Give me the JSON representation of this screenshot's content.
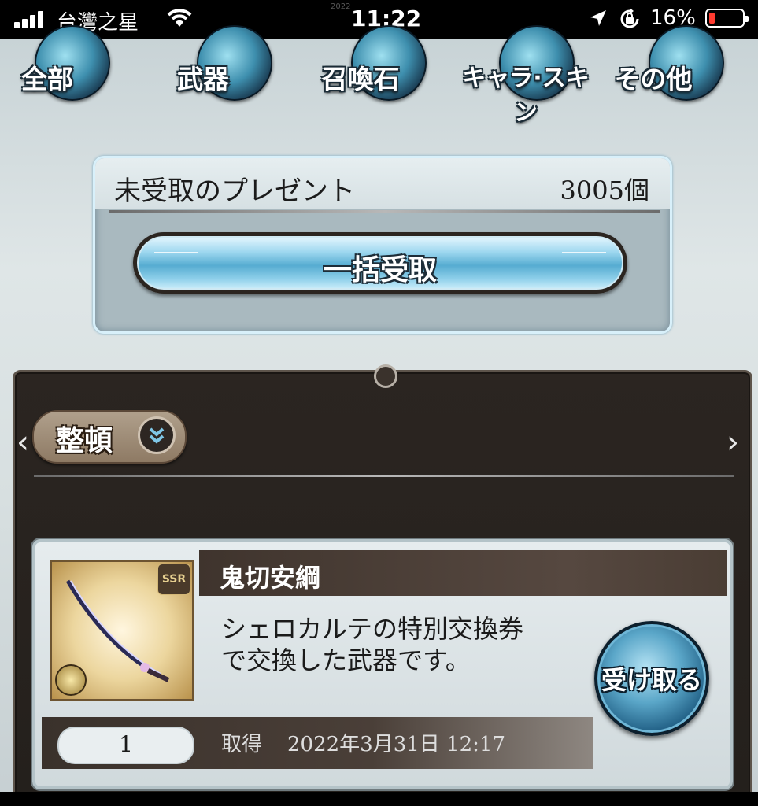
{
  "status_bar": {
    "carrier": "台灣之星",
    "time": "11:22",
    "screenshot_date": "2022",
    "battery_percent": "16%",
    "battery_level": 0.16
  },
  "categories": [
    {
      "label": "全部",
      "icon": "all-icon"
    },
    {
      "label": "武器",
      "icon": "sword-icon"
    },
    {
      "label": "召喚石",
      "icon": "summon-stone-icon"
    },
    {
      "label": "キャラ·スキン",
      "icon": "character-skin-icon"
    },
    {
      "label": "その他",
      "icon": "more-dots-icon"
    }
  ],
  "present_summary": {
    "title": "未受取のプレゼント",
    "count": "3005個",
    "bulk_receive_label": "一括受取"
  },
  "list": {
    "sort_label": "整頓",
    "prev_arrow": "‹",
    "next_arrow": "›"
  },
  "item": {
    "name": "鬼切安綱",
    "rarity": "SSR",
    "description_line1": "シェロカルテの特別交換券",
    "description_line2": "で交換した武器です。",
    "quantity": "1",
    "acquired_label": "取得",
    "acquired_date": "2022年3月31日 12:17",
    "receive_label": "受け取る"
  },
  "colors": {
    "panel_bg": "#24201c",
    "button_blue": "#56acd1",
    "battery_low": "#ff3b30"
  }
}
